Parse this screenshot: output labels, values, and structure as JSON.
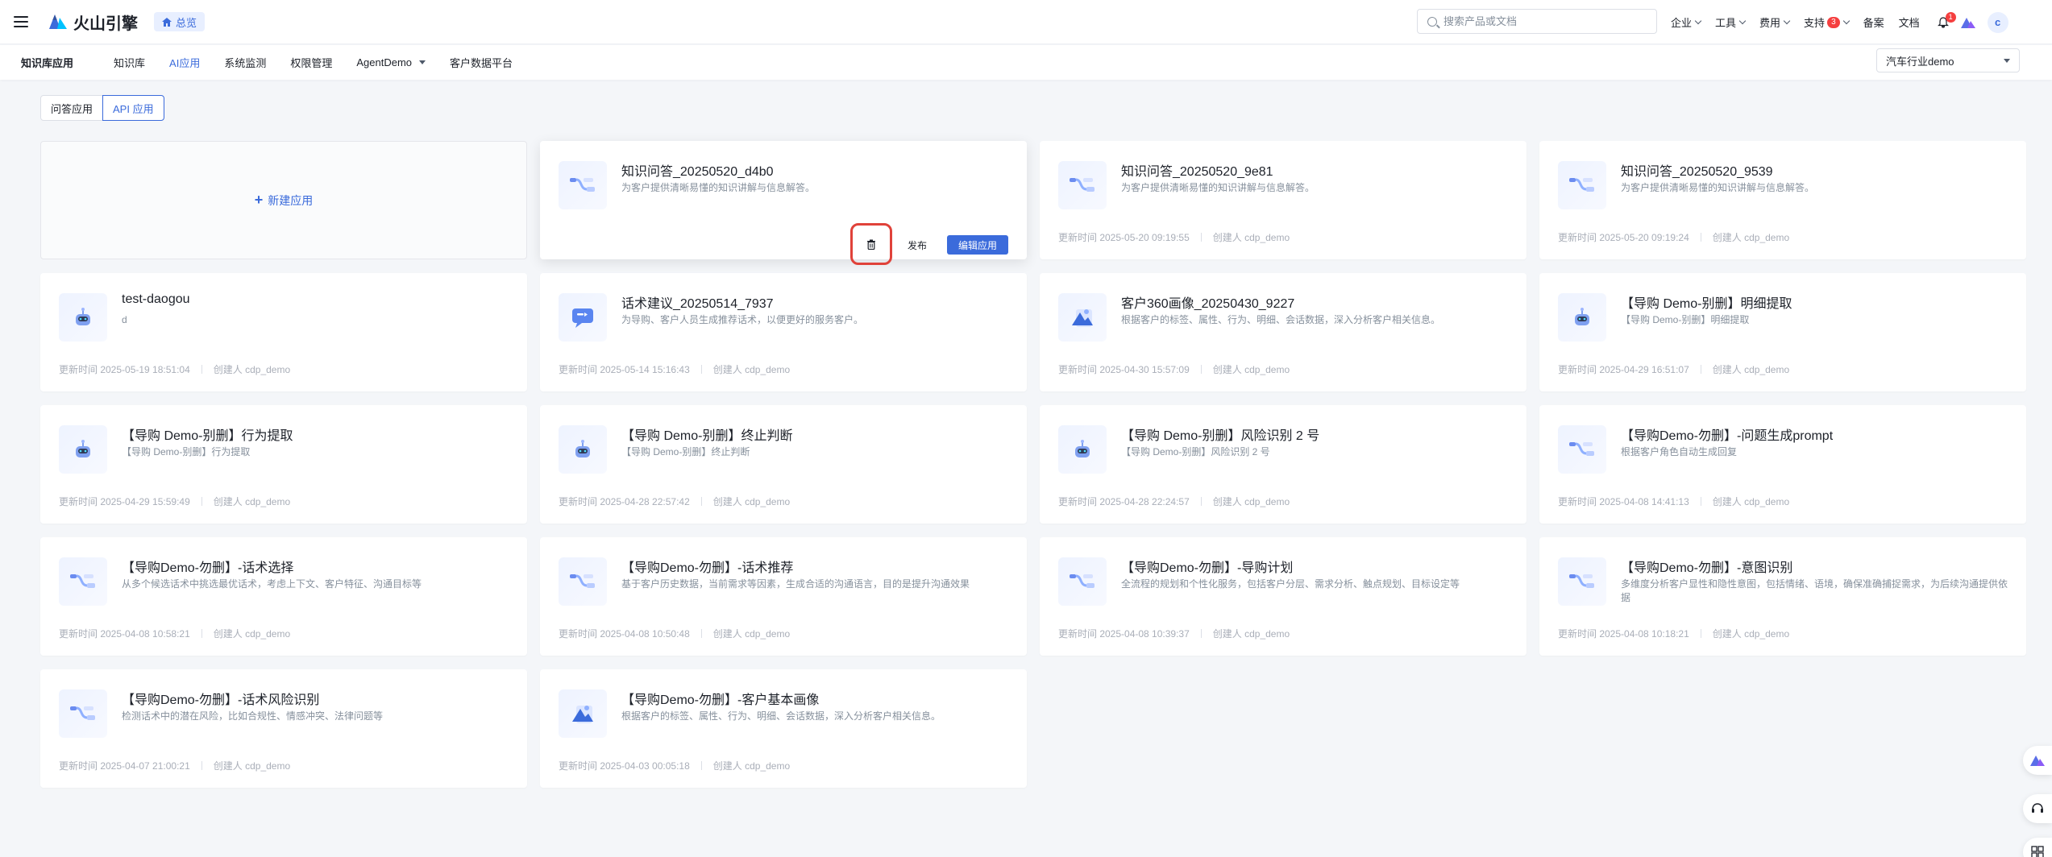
{
  "header": {
    "logo_text": "火山引擎",
    "home_label": "总览",
    "search_placeholder": "搜索产品或文档",
    "nav": [
      {
        "label": "企业",
        "has_chevron": true
      },
      {
        "label": "工具",
        "has_chevron": true
      },
      {
        "label": "费用",
        "has_chevron": true
      },
      {
        "label": "支持",
        "has_chevron": true,
        "badge": "3"
      },
      {
        "label": "备案",
        "has_chevron": false
      },
      {
        "label": "文档",
        "has_chevron": false
      }
    ],
    "bell_badge": "1",
    "avatar_letter": "c"
  },
  "subnav": {
    "brand": "知识库应用",
    "tabs": [
      {
        "label": "知识库",
        "active": false
      },
      {
        "label": "AI应用",
        "active": true
      },
      {
        "label": "系统监测",
        "active": false
      },
      {
        "label": "权限管理",
        "active": false
      },
      {
        "label": "AgentDemo",
        "active": false,
        "dropdown": true
      },
      {
        "label": "客户数据平台",
        "active": false
      }
    ],
    "workspace_select": "汽车行业demo"
  },
  "toggle": {
    "options": [
      "问答应用",
      "API 应用"
    ],
    "active": "API 应用"
  },
  "new_app_label": "新建应用",
  "labels": {
    "updated": "更新时间",
    "creator": "创建人",
    "publish": "发布",
    "edit": "编辑应用"
  },
  "cards": [
    {
      "title": "知识问答_20250520_d4b0",
      "desc": "为客户提供清晰易懂的知识讲解与信息解答。",
      "updated": "",
      "creator": "",
      "icon": "flow-icon",
      "hovered": true
    },
    {
      "title": "知识问答_20250520_9e81",
      "desc": "为客户提供清晰易懂的知识讲解与信息解答。",
      "updated": "2025-05-20 09:19:55",
      "creator": "cdp_demo",
      "icon": "flow-icon"
    },
    {
      "title": "知识问答_20250520_9539",
      "desc": "为客户提供清晰易懂的知识讲解与信息解答。",
      "updated": "2025-05-20 09:19:24",
      "creator": "cdp_demo",
      "icon": "flow-icon"
    },
    {
      "title": "test-daogou",
      "desc": "d",
      "updated": "2025-05-19 18:51:04",
      "creator": "cdp_demo",
      "icon": "robot-icon"
    },
    {
      "title": "话术建议_20250514_7937",
      "desc": "为导购、客户人员生成推荐话术，以便更好的服务客户。",
      "updated": "2025-05-14 15:16:43",
      "creator": "cdp_demo",
      "icon": "chat-icon"
    },
    {
      "title": "客户360画像_20250430_9227",
      "desc": "根据客户的标签、属性、行为、明细、会话数据，深入分析客户相关信息。",
      "updated": "2025-04-30 15:57:09",
      "creator": "cdp_demo",
      "icon": "portrait-icon"
    },
    {
      "title": "【导购 Demo-别删】明细提取",
      "desc": "【导购 Demo-别删】明细提取",
      "updated": "2025-04-29 16:51:07",
      "creator": "cdp_demo",
      "icon": "robot-icon"
    },
    {
      "title": "【导购 Demo-别删】行为提取",
      "desc": "【导购 Demo-别删】行为提取",
      "updated": "2025-04-29 15:59:49",
      "creator": "cdp_demo",
      "icon": "robot-icon"
    },
    {
      "title": "【导购 Demo-别删】终止判断",
      "desc": "【导购 Demo-别删】终止判断",
      "updated": "2025-04-28 22:57:42",
      "creator": "cdp_demo",
      "icon": "robot-icon"
    },
    {
      "title": "【导购 Demo-别删】风险识别 2 号",
      "desc": "【导购 Demo-别删】风险识别 2 号",
      "updated": "2025-04-28 22:24:57",
      "creator": "cdp_demo",
      "icon": "robot-icon"
    },
    {
      "title": "【导购Demo-勿删】-问题生成prompt",
      "desc": "根据客户角色自动生成回复",
      "updated": "2025-04-08 14:41:13",
      "creator": "cdp_demo",
      "icon": "flow-icon"
    },
    {
      "title": "【导购Demo-勿删】-话术选择",
      "desc": "从多个候选话术中挑选最优话术，考虑上下文、客户特征、沟通目标等",
      "updated": "2025-04-08 10:58:21",
      "creator": "cdp_demo",
      "icon": "flow-icon"
    },
    {
      "title": "【导购Demo-勿删】-话术推荐",
      "desc": "基于客户历史数据，当前需求等因素，生成合适的沟通语言，目的是提升沟通效果",
      "updated": "2025-04-08 10:50:48",
      "creator": "cdp_demo",
      "icon": "flow-icon"
    },
    {
      "title": "【导购Demo-勿删】-导购计划",
      "desc": "全流程的规划和个性化服务，包括客户分层、需求分析、触点规划、目标设定等",
      "updated": "2025-04-08 10:39:37",
      "creator": "cdp_demo",
      "icon": "flow-icon"
    },
    {
      "title": "【导购Demo-勿删】-意图识别",
      "desc": "多维度分析客户显性和隐性意图，包括情绪、语境，确保准确捕捉需求，为后续沟通提供依据",
      "updated": "2025-04-08 10:18:21",
      "creator": "cdp_demo",
      "icon": "flow-icon"
    },
    {
      "title": "【导购Demo-勿删】-话术风险识别",
      "desc": "检测话术中的潜在风险，比如合规性、情感冲突、法律问题等",
      "updated": "2025-04-07 21:00:21",
      "creator": "cdp_demo",
      "icon": "flow-icon"
    },
    {
      "title": "【导购Demo-勿删】-客户基本画像",
      "desc": "根据客户的标签、属性、行为、明细、会话数据，深入分析客户相关信息。",
      "updated": "2025-04-03 00:05:18",
      "creator": "cdp_demo",
      "icon": "portrait-icon"
    }
  ]
}
